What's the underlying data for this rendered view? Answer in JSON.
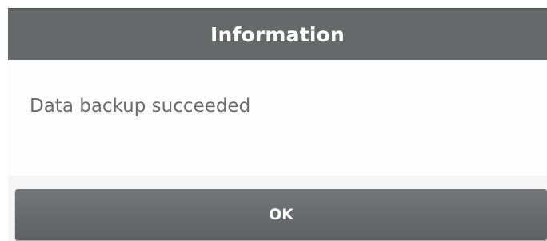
{
  "dialog": {
    "title": "Information",
    "message": "Data backup succeeded",
    "ok_label": "OK"
  },
  "colors": {
    "header_bg": "#67686a",
    "button_bg": "#6a6b6f",
    "text_primary": "#6b6b6b"
  }
}
